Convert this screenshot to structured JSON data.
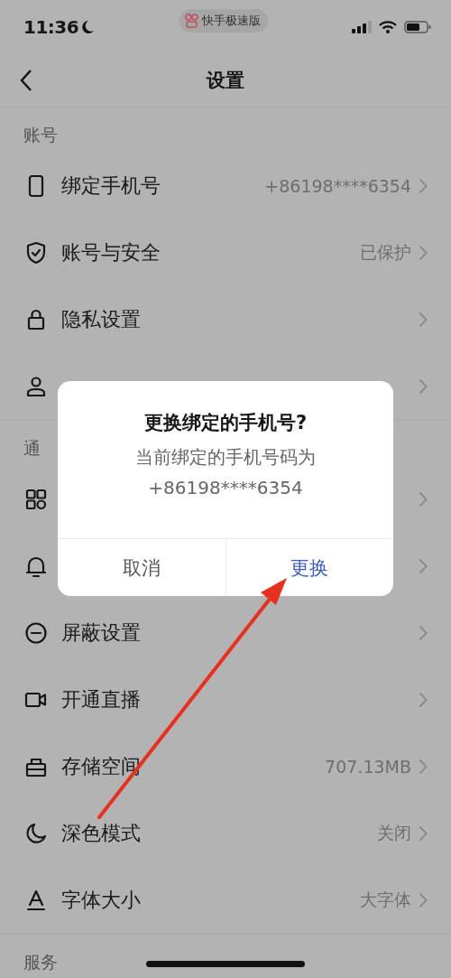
{
  "status_bar": {
    "time": "11:36",
    "app_badge": "快手极速版"
  },
  "nav": {
    "title": "设置"
  },
  "sections": [
    {
      "title": "账号",
      "items": [
        {
          "kind": "link",
          "label": "绑定手机号",
          "value": "+86198****6354"
        },
        {
          "kind": "link",
          "label": "账号与安全",
          "value": "已保护"
        },
        {
          "kind": "link",
          "label": "隐私设置"
        },
        {
          "kind": "link"
        }
      ]
    },
    {
      "title": "通",
      "items": [
        {
          "kind": "link"
        },
        {
          "kind": "link"
        },
        {
          "kind": "link",
          "label": "屏蔽设置"
        },
        {
          "kind": "link",
          "label": "开通直播"
        },
        {
          "kind": "link",
          "label": "存储空间",
          "value": "707.13MB"
        },
        {
          "kind": "link",
          "label": "深色模式",
          "value": "关闭"
        },
        {
          "kind": "link",
          "label": "字体大小",
          "value": "大字体"
        }
      ]
    },
    {
      "title": "服务"
    }
  ],
  "dialog": {
    "title": "更换绑定的手机号?",
    "message_lines": [
      "当前绑定的手机号码为",
      "+86198****6354"
    ],
    "buttons": [
      {
        "label": "取消",
        "kind": "cancel"
      },
      {
        "label": "更换",
        "kind": "confirm"
      }
    ]
  }
}
